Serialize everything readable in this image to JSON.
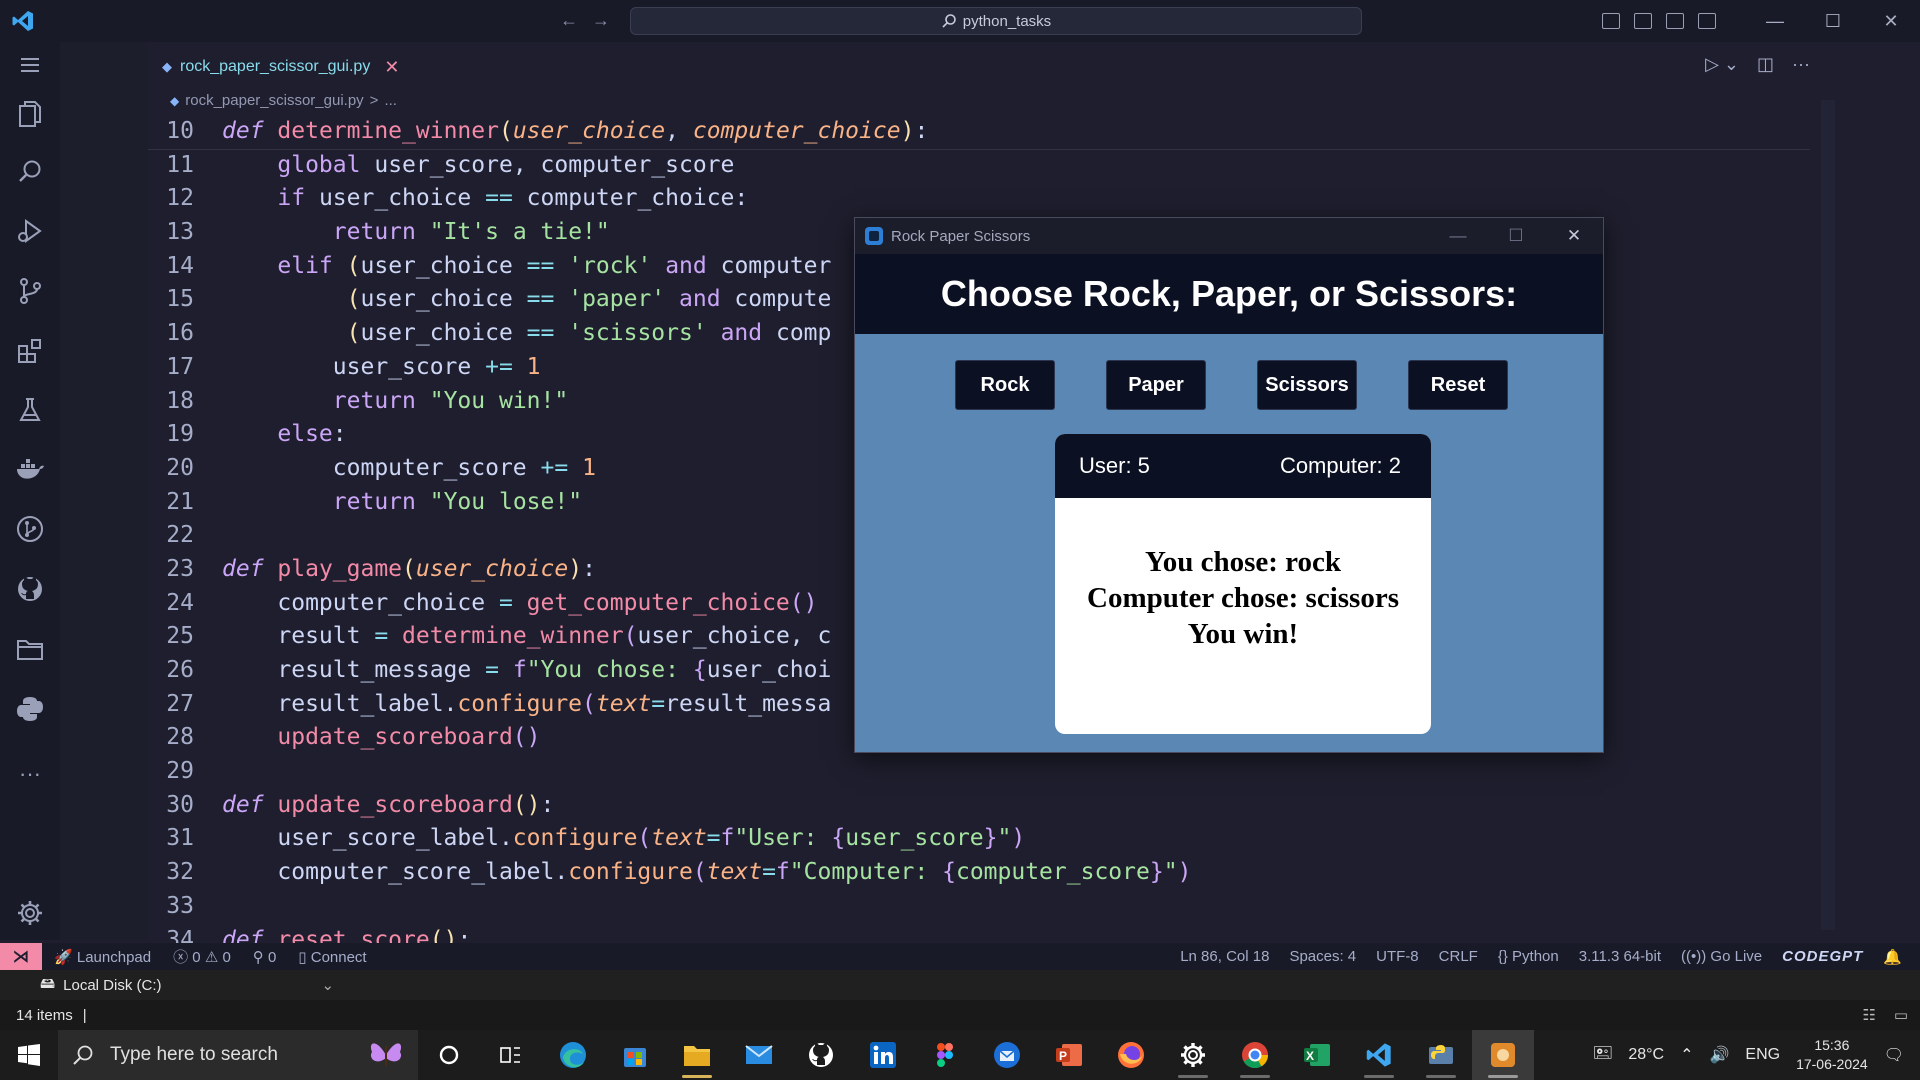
{
  "window": {
    "search_text": "python_tasks",
    "controls": {
      "minimize": "—",
      "maximize": "☐",
      "close": "✕"
    }
  },
  "editor": {
    "tab_label": "rock_paper_scissor_gui.py",
    "tab_close": "✕",
    "breadcrumb_file": "rock_paper_scissor_gui.py",
    "breadcrumb_sep": ">",
    "breadcrumb_more": "..."
  },
  "code": {
    "line_numbers": [
      "10",
      "11",
      "12",
      "13",
      "14",
      "15",
      "16",
      "17",
      "18",
      "19",
      "20",
      "21",
      "22",
      "23",
      "24",
      "25",
      "26",
      "27",
      "28",
      "29",
      "30",
      "31",
      "32",
      "33",
      "34"
    ]
  },
  "status_bar": {
    "launchpad": "Launchpad",
    "errors": "0",
    "warnings": "0",
    "ports": "0",
    "connect": "Connect",
    "position": "Ln 86, Col 18",
    "spaces": "Spaces: 4",
    "encoding": "UTF-8",
    "eol": "CRLF",
    "language": "Python",
    "interpreter": "3.11.3 64-bit",
    "go_live": "Go Live",
    "codegpt": "CODEGPT"
  },
  "explorer": {
    "location": "Local Disk (C:)",
    "items_count": "14 items",
    "separator": "|"
  },
  "taskbar": {
    "search_placeholder": "Type here to search",
    "temperature": "28°C",
    "language": "ENG",
    "time": "15:36",
    "date": "17-06-2024"
  },
  "game_window": {
    "title": "Rock Paper Scissors",
    "heading": "Choose Rock, Paper, or Scissors:",
    "buttons": [
      "Rock",
      "Paper",
      "Scissors",
      "Reset"
    ],
    "user_score": "User: 5",
    "computer_score": "Computer: 2",
    "result_lines": [
      "You chose: rock",
      "Computer chose: scissors",
      "You win!"
    ]
  },
  "colors": {
    "editor_bg": "#1e1e2e",
    "game_bg": "#5b87b4",
    "game_dark": "#0b1022",
    "remote_accent": "#f38ba8"
  }
}
